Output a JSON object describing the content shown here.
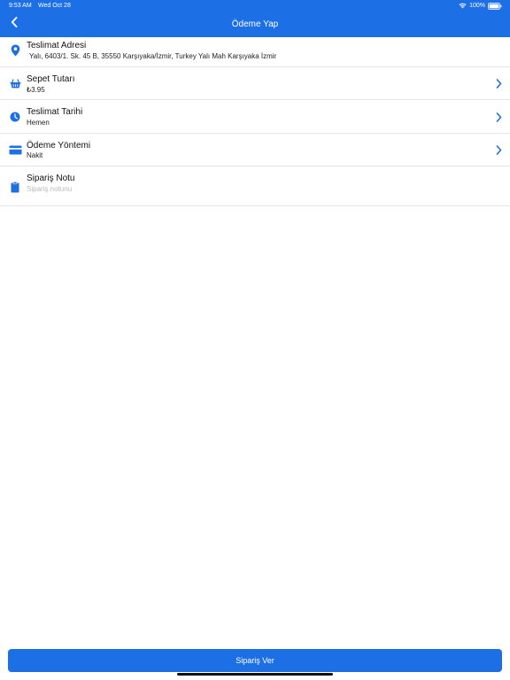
{
  "status_bar": {
    "time": "9:53 AM",
    "date": "Wed Oct 28",
    "battery": "100%"
  },
  "header": {
    "title": "Ödeme Yap",
    "back_icon": "chevron-left-icon"
  },
  "rows": [
    {
      "icon": "location-pin-icon",
      "title": "Teslimat Adresi",
      "subtitle": "Yalı, 6403/1. Sk. 45 B, 35550 Karşıyaka/İzmir, Turkey Yalı Mah Karşıyaka İzmir",
      "has_chevron": false
    },
    {
      "icon": "basket-icon",
      "title": "Sepet Tutarı",
      "subtitle": "₺3.95",
      "has_chevron": true
    },
    {
      "icon": "clock-icon",
      "title": "Teslimat Tarihi",
      "subtitle": "Hemen",
      "has_chevron": true
    },
    {
      "icon": "credit-card-icon",
      "title": "Ödeme Yöntemi",
      "subtitle": "Nakit",
      "has_chevron": true
    },
    {
      "icon": "clipboard-icon",
      "title": "Sipariş Notu",
      "placeholder": "Sipariş notunu",
      "has_chevron": false
    }
  ],
  "footer": {
    "order_button_label": "Sipariş Ver"
  },
  "colors": {
    "accent": "#1d6fe6",
    "divider": "#e6e6e6",
    "placeholder": "#b9b9b9"
  }
}
